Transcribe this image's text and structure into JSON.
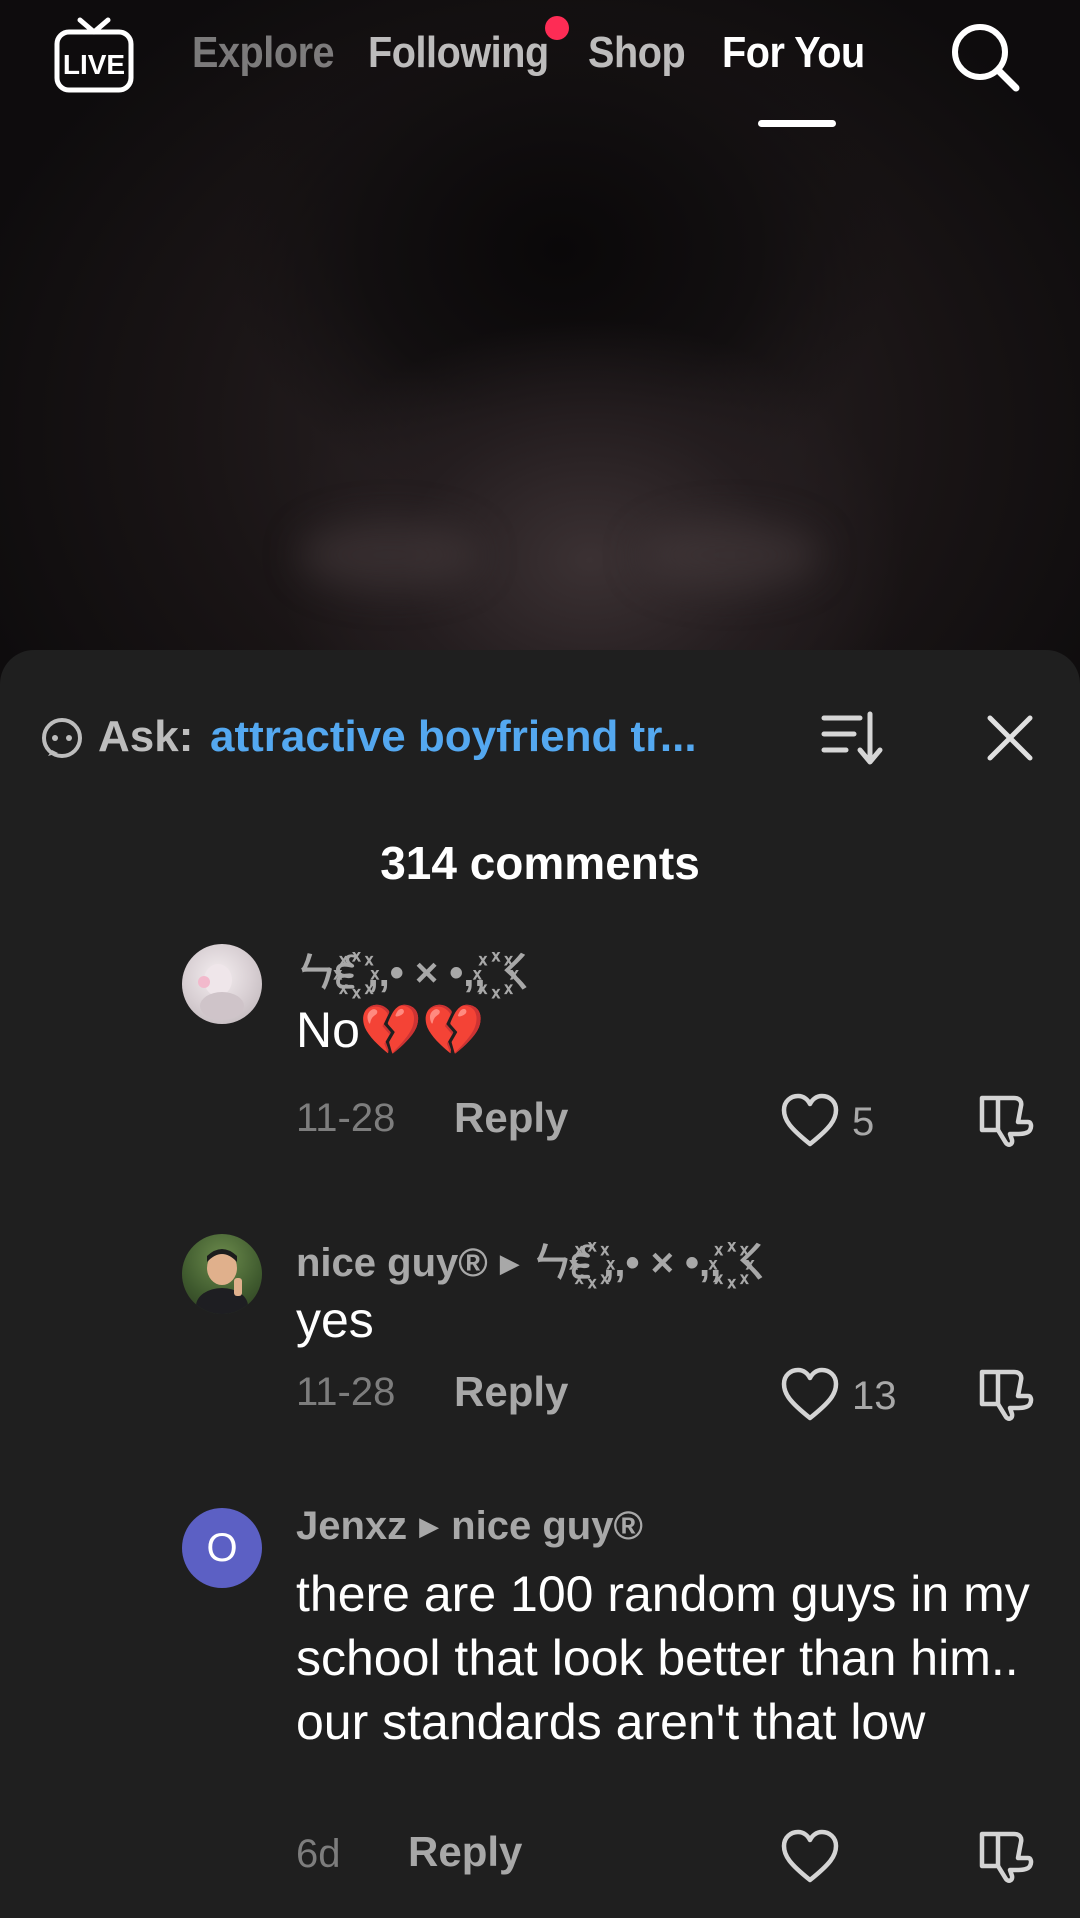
{
  "nav": {
    "live_label": "LIVE",
    "tabs": [
      {
        "label": "Explore"
      },
      {
        "label": "Following"
      },
      {
        "label": "Shop"
      },
      {
        "label": "For You",
        "active": true
      }
    ],
    "icons": {
      "live": "live-tv-icon",
      "search": "search-icon"
    },
    "notification_dot_color": "#fe2c55"
  },
  "sheet": {
    "ask_label": "Ask:",
    "ask_query": "attractive boyfriend tr...",
    "ask_icon": "chat-bot-icon",
    "sort_icon": "sort-icon",
    "close_icon": "close-icon",
    "comment_count": "314 comments",
    "accent_color": "#54a8f0"
  },
  "comments": [
    {
      "username": "ㄣ੬꙰ ,,• × •,, ꙰ㄑ",
      "reply_to": "",
      "text": "No💔💔",
      "date": "11-28",
      "reply_label": "Reply",
      "likes": "5",
      "avatar": "photo-avatar"
    },
    {
      "username": "nice guy®",
      "reply_to": "ㄣ੬꙰ ,,• × •,, ꙰ㄑ",
      "text": "yes",
      "date": "11-28",
      "reply_label": "Reply",
      "likes": "13",
      "avatar": "photo-avatar"
    },
    {
      "username": "Jenxz",
      "reply_to": "nice guy®",
      "text": "there are 100 random guys in my school that look better than him.. our standards aren't that low",
      "date": "6d",
      "reply_label": "Reply",
      "likes": "",
      "avatar_letter": "O",
      "avatar_color": "#5c60c4"
    }
  ]
}
